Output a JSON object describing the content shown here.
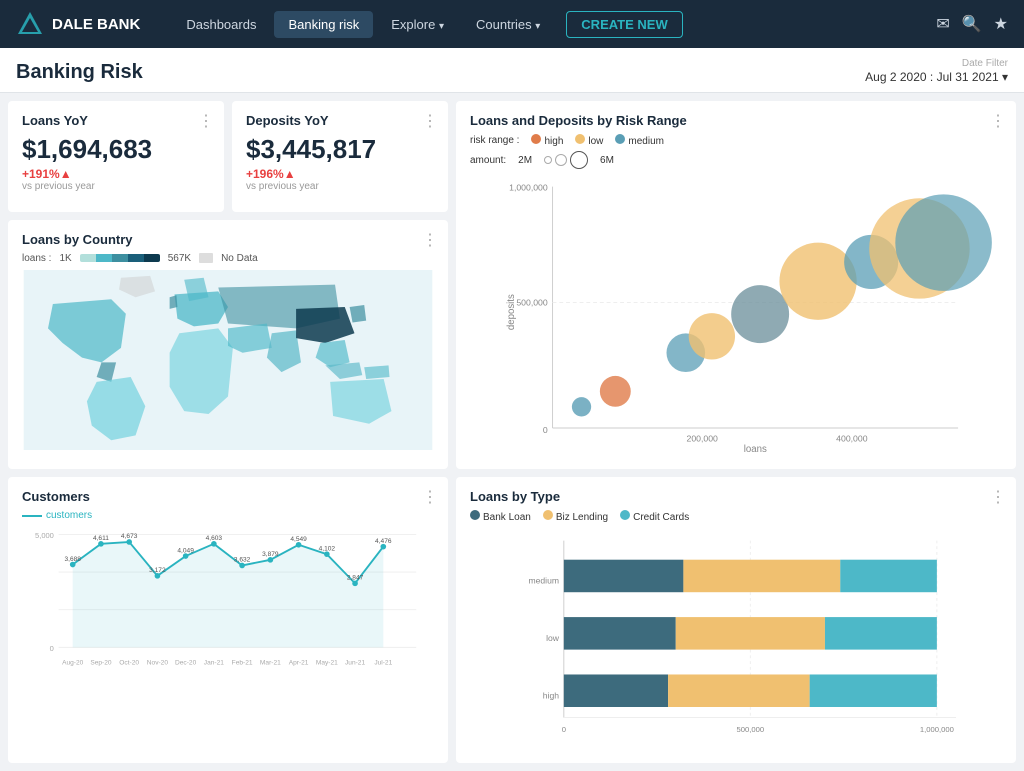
{
  "navbar": {
    "brand": "DALE BANK",
    "links": [
      {
        "label": "Dashboards",
        "active": false
      },
      {
        "label": "Banking risk",
        "active": true
      },
      {
        "label": "Explore",
        "active": false,
        "dropdown": true
      },
      {
        "label": "Countries",
        "active": false,
        "dropdown": true
      }
    ],
    "create_label": "CREATE NEW"
  },
  "page": {
    "title": "Banking Risk",
    "date_filter_label": "Date Filter",
    "date_filter_value": "Aug 2 2020 : Jul 31 2021"
  },
  "kpi": [
    {
      "title": "Loans YoY",
      "value": "$1,694,683",
      "change": "+191%",
      "change_arrow": "▲",
      "sub": "vs previous year"
    },
    {
      "title": "Deposits YoY",
      "value": "$3,445,817",
      "change": "+196%",
      "change_arrow": "▲",
      "sub": "vs previous year"
    }
  ],
  "loans_by_country": {
    "title": "Loans by Country",
    "legend_min": "1K",
    "legend_max": "567K",
    "no_data": "No Data"
  },
  "scatter": {
    "title": "Loans and Deposits by Risk Range",
    "risk_label": "risk range :",
    "amount_label": "amount:",
    "amount_min": "2M",
    "amount_max": "6M",
    "legend": [
      {
        "label": "high",
        "color": "#e07c4a"
      },
      {
        "label": "low",
        "color": "#f0c070"
      },
      {
        "label": "medium",
        "color": "#5a9eb5"
      }
    ],
    "x_axis_label": "loans",
    "y_axis_label": "deposits",
    "x_ticks": [
      "200,000",
      "400,000"
    ],
    "y_ticks": [
      "500,000",
      "1,000,000"
    ],
    "bubbles": [
      {
        "cx": 0.08,
        "cy": 0.92,
        "r": 14,
        "color": "#5a9eb5"
      },
      {
        "cx": 0.14,
        "cy": 0.85,
        "r": 20,
        "color": "#e07c4a"
      },
      {
        "cx": 0.38,
        "cy": 0.62,
        "r": 26,
        "color": "#5a9eb5"
      },
      {
        "cx": 0.44,
        "cy": 0.55,
        "r": 30,
        "color": "#f0c070"
      },
      {
        "cx": 0.52,
        "cy": 0.48,
        "r": 36,
        "color": "#6a8e9a"
      },
      {
        "cx": 0.63,
        "cy": 0.35,
        "r": 44,
        "color": "#f0c070"
      },
      {
        "cx": 0.72,
        "cy": 0.28,
        "r": 32,
        "color": "#5a9eb5"
      },
      {
        "cx": 0.82,
        "cy": 0.22,
        "r": 58,
        "color": "#f0c070"
      },
      {
        "cx": 0.91,
        "cy": 0.2,
        "r": 56,
        "color": "#5a9eb5"
      }
    ]
  },
  "customers": {
    "title": "Customers",
    "legend": "customers",
    "y_max": 5000,
    "y_min": 0,
    "data_points": [
      {
        "label": "Aug-20",
        "value": 3688
      },
      {
        "label": "Sep-20",
        "value": 4611
      },
      {
        "label": "Oct-20",
        "value": 4673
      },
      {
        "label": "Nov-20",
        "value": 3172
      },
      {
        "label": "Dec-20",
        "value": 4049
      },
      {
        "label": "Jan-21",
        "value": 4603
      },
      {
        "label": "Feb-21",
        "value": 3632
      },
      {
        "label": "Mar-21",
        "value": 3879
      },
      {
        "label": "Apr-21",
        "value": 4549
      },
      {
        "label": "May-21",
        "value": 4102
      },
      {
        "label": "Jun-21",
        "value": 2847
      },
      {
        "label": "Jul-21",
        "value": 4476
      }
    ]
  },
  "loans_by_type": {
    "title": "Loans by Type",
    "legend": [
      {
        "label": "Bank Loan",
        "color": "#3d6b7d"
      },
      {
        "label": "Biz Lending",
        "color": "#f0c070"
      },
      {
        "label": "Credit Cards",
        "color": "#4db8c8"
      }
    ],
    "categories": [
      {
        "label": "medium",
        "segments": [
          {
            "value": 0.32,
            "color": "#3d6b7d"
          },
          {
            "value": 0.42,
            "color": "#f0c070"
          },
          {
            "value": 0.26,
            "color": "#4db8c8"
          }
        ]
      },
      {
        "label": "low",
        "segments": [
          {
            "value": 0.3,
            "color": "#3d6b7d"
          },
          {
            "value": 0.4,
            "color": "#f0c070"
          },
          {
            "value": 0.3,
            "color": "#4db8c8"
          }
        ]
      },
      {
        "label": "high",
        "segments": [
          {
            "value": 0.28,
            "color": "#3d6b7d"
          },
          {
            "value": 0.38,
            "color": "#f0c070"
          },
          {
            "value": 0.34,
            "color": "#4db8c8"
          }
        ]
      }
    ],
    "x_ticks": [
      "0",
      "500,000",
      "1,000,000"
    ]
  }
}
